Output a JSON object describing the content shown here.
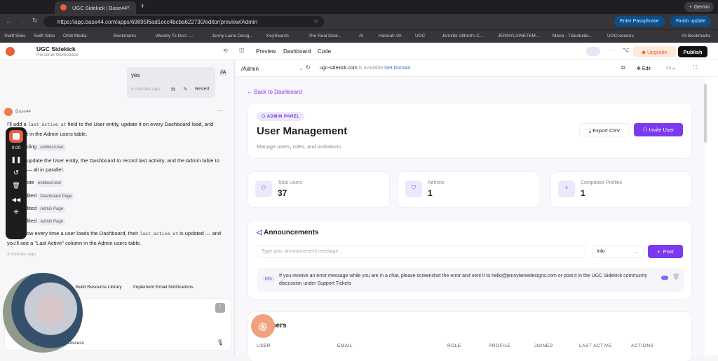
{
  "browser": {
    "tab_title": "UGC Sidekick | Base44",
    "url": "https://app.base44.com/apps/69895f6ad1ecc4bcba622730/editor/preview/Admin",
    "enter_passphrase": "Enter Passphrase",
    "finish_update": "Finish update",
    "gemini": "Gemini",
    "bookmarks": [
      "Swift Sites",
      "Swift Sites",
      "Orbit Media",
      "Bookmarks",
      "Weekly To Do's -...",
      "Jenny Laine Desig...",
      "KeySearch",
      "The Real Deal...",
      "AI",
      "Hannah VA",
      "UGC",
      "Jennifer Allford's C...",
      "JENNYLAINETEM...",
      "Maria - Tidestudio...",
      "UGCcreators",
      "All Bookmarks"
    ]
  },
  "app": {
    "name": "UGC Sidekick",
    "workspace": "Personal Workspace",
    "tabs": [
      "Preview",
      "Dashboard",
      "Code"
    ],
    "upgrade": "Upgrade",
    "publish": "Publish",
    "avatar": "JA"
  },
  "chat": {
    "user_msg": "yes",
    "user_time": "4 minutes ago",
    "revert": "Revert",
    "bot_name": "Base44",
    "intro_a": "I'll add a",
    "intro_code": "last_active_at",
    "intro_b": "field to the User entity, update it on every Dashboard load, and",
    "intro_c": "t in the Admin users table.",
    "steps": [
      {
        "verb": "ading",
        "chip": "entities/User"
      },
      {
        "verb": "rote",
        "chip": "entities/User"
      },
      {
        "verb": "dited",
        "chip": "Dashboard Page"
      },
      {
        "verb": "dited",
        "chip": "Admin Page"
      },
      {
        "verb": "dited",
        "chip": "Admin Page"
      }
    ],
    "plan_a": "update the User entity, the Dashboard to record last activity, and the Admin table to",
    "plan_b": "— all in parallel.",
    "done_a": "ow every time a user loads the Dashboard, their",
    "done_code": "last_active_at",
    "done_b": "is updated — and",
    "done_c": "you'll see a \"Last Active\" column in the Admin users table.",
    "bot_time": "3 minutes ago",
    "suggestions": [
      "Build Resource Library",
      "Implement Email Notifications"
    ],
    "discuss": "Discuss",
    "recorder_time": "0:00"
  },
  "preview": {
    "path": "/Admin",
    "domain": "ugc-sidekick.com",
    "available": "is available",
    "get_domain": "Get Domain",
    "edit": "Edit",
    "back": "Back to Dashboard",
    "badge": "ADMIN PANEL",
    "title": "User Management",
    "subtitle": "Manage users, roles, and invitations",
    "export": "Export CSV",
    "invite": "Invite User",
    "stats": [
      {
        "label": "Total Users",
        "value": "37"
      },
      {
        "label": "Admins",
        "value": "1"
      },
      {
        "label": "Completed Profiles",
        "value": "1"
      }
    ],
    "ann_title": "Announcements",
    "ann_placeholder": "Type your announcement message...",
    "ann_type": "Info",
    "post": "Post",
    "ann_item": {
      "tag": "info",
      "text": "If you receive an error message while you are in a chat, please screenshot the error and sent it to hello@jennylainedesigns.com or post it in the UGC Sidekick community discussion under Support Tickets"
    },
    "users_title": "sers",
    "columns": [
      "USER",
      "EMAIL",
      "ROLE",
      "PROFILE",
      "JOINED",
      "LAST ACTIVE",
      "ACTIONS"
    ]
  },
  "colors": {
    "accent": "#7c3aed",
    "brand": "#e9603a"
  }
}
